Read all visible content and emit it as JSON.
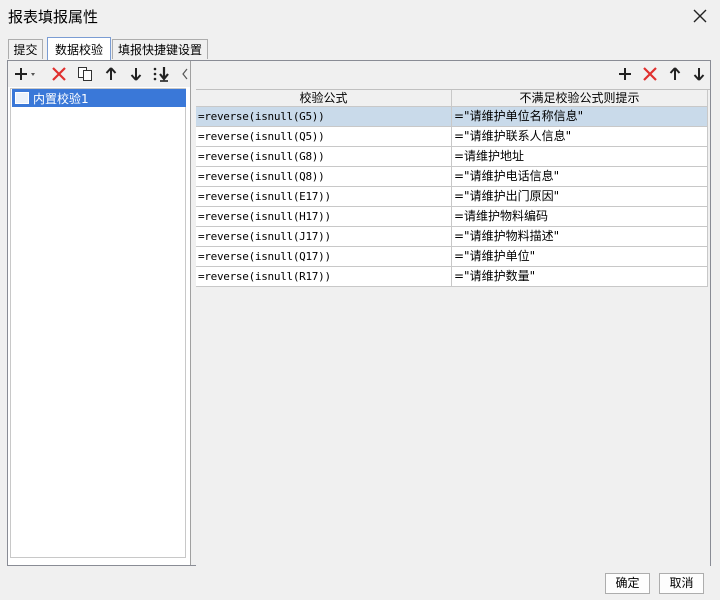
{
  "window": {
    "title": "报表填报属性"
  },
  "tabs": [
    {
      "label": "提交"
    },
    {
      "label": "数据校验"
    },
    {
      "label": "填报快捷键设置"
    }
  ],
  "left_panel": {
    "tree_items": [
      {
        "label": "内置校验1"
      }
    ]
  },
  "grid": {
    "columns": [
      "校验公式",
      "不满足校验公式则提示"
    ],
    "rows": [
      [
        "=reverse(isnull(G5))",
        "=\"请维护单位名称信息\""
      ],
      [
        "=reverse(isnull(Q5))",
        "=\"请维护联系人信息\""
      ],
      [
        "=reverse(isnull(G8))",
        "=请维护地址"
      ],
      [
        "=reverse(isnull(Q8))",
        "=\"请维护电话信息\""
      ],
      [
        "=reverse(isnull(E17))",
        "=\"请维护出门原因\""
      ],
      [
        "=reverse(isnull(H17))",
        "=请维护物料编码"
      ],
      [
        "=reverse(isnull(J17))",
        "=\"请维护物料描述\""
      ],
      [
        "=reverse(isnull(Q17))",
        "=\"请维护单位\""
      ],
      [
        "=reverse(isnull(R17))",
        "=\"请维护数量\""
      ]
    ]
  },
  "footer": {
    "ok_label": "确定",
    "cancel_label": "取消"
  },
  "colors": {
    "delete": "#e0302f",
    "selection": "#3a78d8",
    "row_selected": "#c9daea"
  }
}
